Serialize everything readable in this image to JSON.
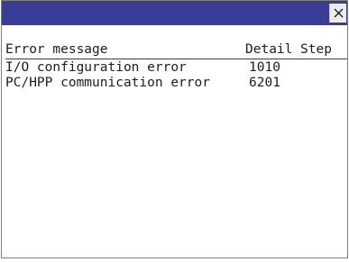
{
  "window": {
    "close_glyph": "×",
    "titlebar_color": "#3a3d94"
  },
  "table": {
    "headers": {
      "message": "Error message",
      "detail": "Detail",
      "step": "Step"
    },
    "rows": [
      {
        "message": "I/O configuration error",
        "detail": "1010",
        "step": ""
      },
      {
        "message": "PC/HPP communication error",
        "detail": "6201",
        "step": ""
      }
    ]
  }
}
